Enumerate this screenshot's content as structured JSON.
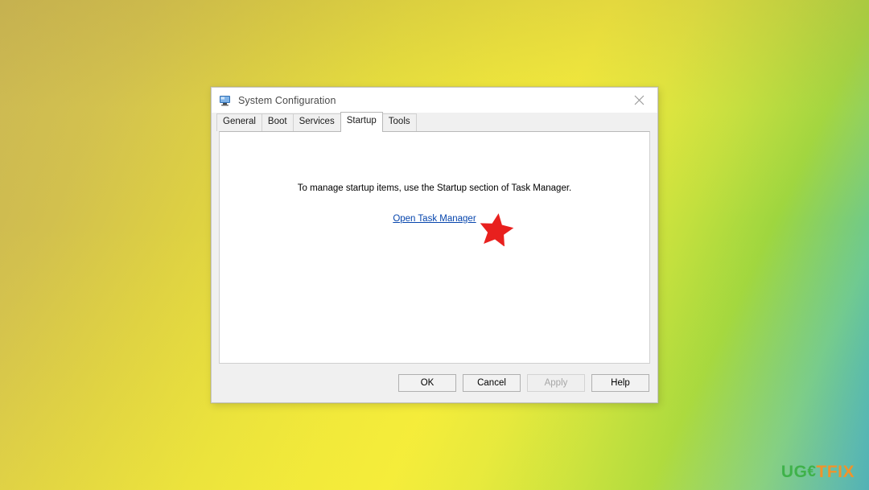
{
  "desktop": {
    "background_colors": {
      "top_left": "#c9b454",
      "top_right": "#23a0d8",
      "bottom_left": "#f4ec3a",
      "bottom_right": "#9ed63f",
      "mid_right": "#9ed63f"
    }
  },
  "dialog": {
    "title": "System Configuration",
    "icon": "system-configuration-icon",
    "close_label": "×",
    "tabs": [
      {
        "label": "General",
        "active": false
      },
      {
        "label": "Boot",
        "active": false
      },
      {
        "label": "Services",
        "active": false
      },
      {
        "label": "Startup",
        "active": true
      },
      {
        "label": "Tools",
        "active": false
      }
    ],
    "content": {
      "instruction": "To manage startup items, use the Startup section of Task Manager.",
      "link_label": "Open Task Manager",
      "link_color": "#0645ad"
    },
    "buttons": [
      {
        "label": "OK",
        "disabled": false
      },
      {
        "label": "Cancel",
        "disabled": false
      },
      {
        "label": "Apply",
        "disabled": true
      },
      {
        "label": "Help",
        "disabled": false
      }
    ]
  },
  "annotation": {
    "shape": "star",
    "color": "#e8201e"
  },
  "watermark": {
    "letters": [
      {
        "char": "U",
        "color": "#3fb24a"
      },
      {
        "char": "G",
        "color": "#3fb24a"
      },
      {
        "char": "€",
        "color": "#3fb24a"
      },
      {
        "char": "T",
        "color": "#f0932b"
      },
      {
        "char": "F",
        "color": "#f0932b"
      },
      {
        "char": "I",
        "color": "#f0932b"
      },
      {
        "char": "X",
        "color": "#f0932b"
      }
    ]
  }
}
